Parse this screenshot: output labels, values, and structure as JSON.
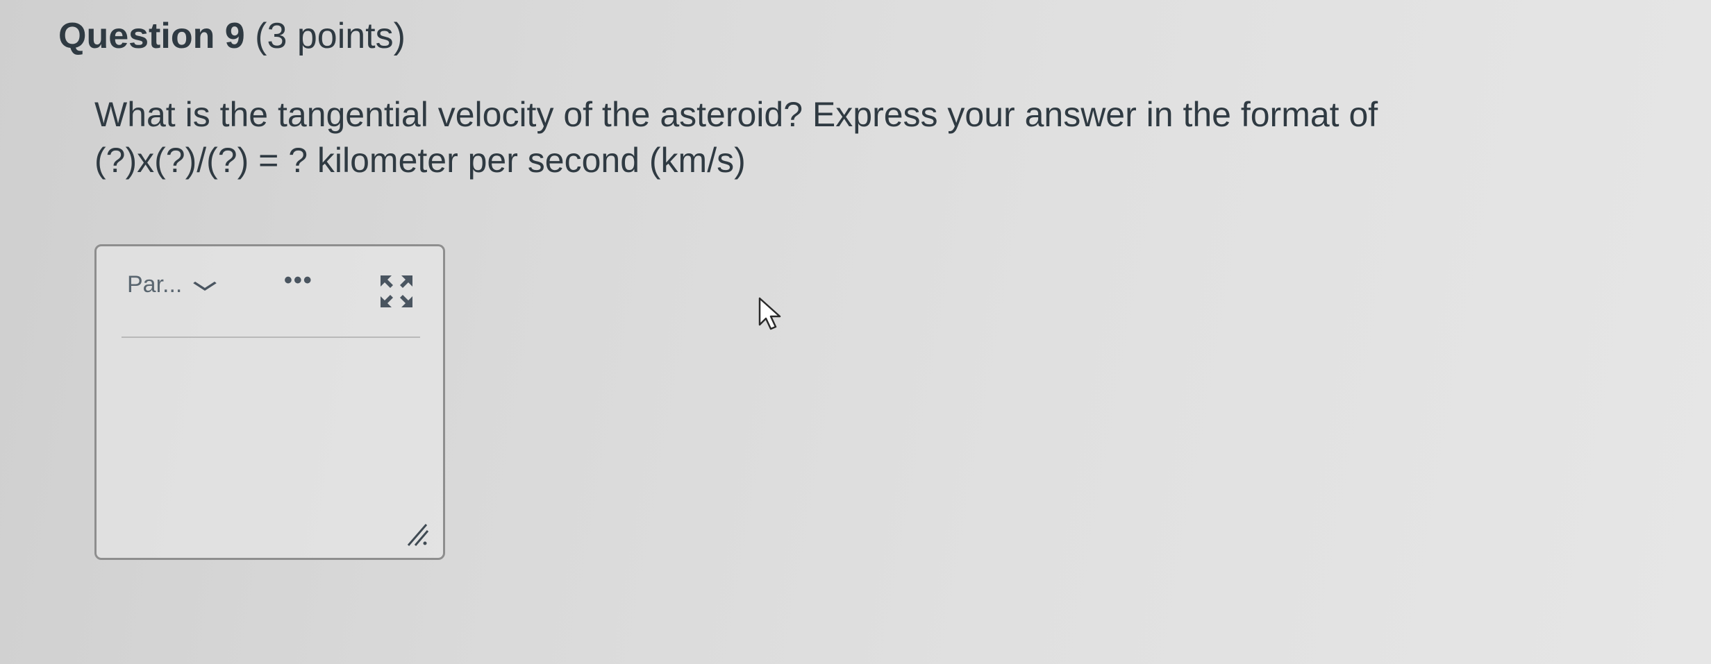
{
  "question": {
    "title": "Question 9",
    "points": "(3 points)",
    "text_line1": "What is the tangential velocity of the asteroid? Express your answer in the format of",
    "text_line2": "(?)x(?)/(?) = ? kilometer per second (km/s)"
  },
  "editor": {
    "format_label": "Par...",
    "more_label": "•••",
    "content": ""
  },
  "icons": {
    "format_chevron": "chevron-down-icon",
    "more": "more-options-icon",
    "fullscreen": "fullscreen-expand-icon",
    "resize": "resize-handle-icon",
    "cursor": "mouse-pointer-icon"
  }
}
